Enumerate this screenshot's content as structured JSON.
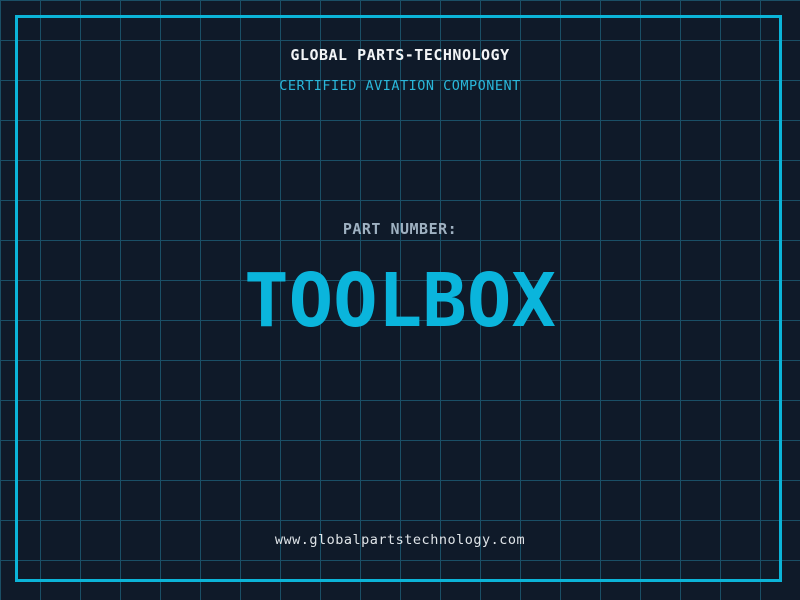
{
  "theme": {
    "background_color": "#0f1a29",
    "grid_line_color": "#1a4f66",
    "frame_color": "#0bb4d8",
    "company_name_color": "#f2f4f6",
    "certification_color": "#2ab7da",
    "part_label_color": "#9fb1c1",
    "part_number_color": "#0ab5dc",
    "website_color": "#dfe4e8"
  },
  "header": {
    "company_name": "GLOBAL PARTS-TECHNOLOGY",
    "certification": "CERTIFIED AVIATION COMPONENT"
  },
  "part": {
    "label": "PART NUMBER:",
    "number": "TOOLBOX"
  },
  "footer": {
    "website": "www.globalpartstechnology.com"
  }
}
